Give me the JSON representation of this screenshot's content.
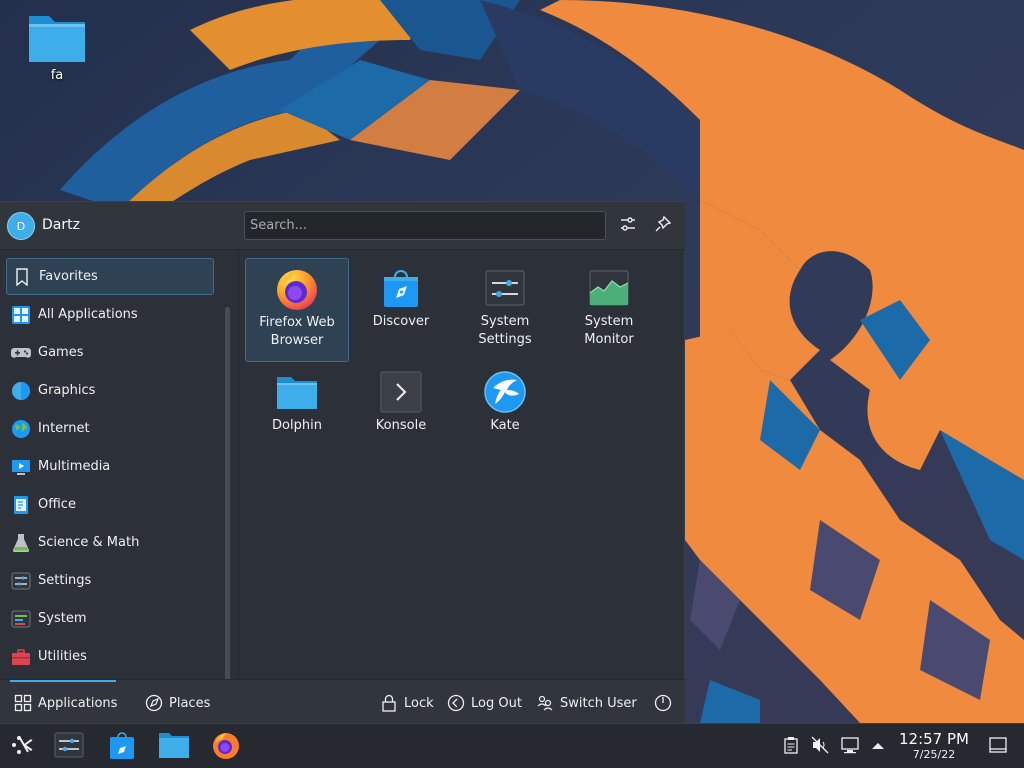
{
  "desktop": {
    "icon_label": "fa",
    "icon_name": "folder-icon"
  },
  "launcher": {
    "user": {
      "name": "Dartz",
      "avatar_initial": "D"
    },
    "search": {
      "placeholder": "Search..."
    },
    "categories": [
      {
        "label": "Favorites",
        "icon": "bookmark-icon",
        "active": true
      },
      {
        "label": "All Applications",
        "icon": "grid-apps-icon"
      },
      {
        "label": "Games",
        "icon": "gamepad-icon"
      },
      {
        "label": "Graphics",
        "icon": "graphics-icon"
      },
      {
        "label": "Internet",
        "icon": "globe-icon"
      },
      {
        "label": "Multimedia",
        "icon": "multimedia-icon"
      },
      {
        "label": "Office",
        "icon": "office-icon"
      },
      {
        "label": "Science & Math",
        "icon": "flask-icon"
      },
      {
        "label": "Settings",
        "icon": "settings-icon"
      },
      {
        "label": "System",
        "icon": "system-icon"
      },
      {
        "label": "Utilities",
        "icon": "toolbox-icon"
      }
    ],
    "favorites": [
      {
        "line1": "Firefox Web",
        "line2": "Browser",
        "icon": "firefox-icon",
        "active": true
      },
      {
        "line1": "Discover",
        "line2": "",
        "icon": "discover-icon"
      },
      {
        "line1": "System",
        "line2": "Settings",
        "icon": "system-settings-icon"
      },
      {
        "line1": "System",
        "line2": "Monitor",
        "icon": "system-monitor-icon"
      },
      {
        "line1": "Dolphin",
        "line2": "",
        "icon": "dolphin-icon"
      },
      {
        "line1": "Konsole",
        "line2": "",
        "icon": "konsole-icon"
      },
      {
        "line1": "Kate",
        "line2": "",
        "icon": "kate-icon"
      }
    ],
    "footer": {
      "applications": "Applications",
      "places": "Places",
      "lock": "Lock",
      "logout": "Log Out",
      "switch_user": "Switch User"
    }
  },
  "taskbar": {
    "clock": {
      "time": "12:57 PM",
      "date": "7/25/22"
    }
  },
  "colors": {
    "accent": "#3daee9",
    "panel": "#2c3139",
    "taskbar": "#262a30",
    "wallpaper_orange": "#f08a3e"
  }
}
